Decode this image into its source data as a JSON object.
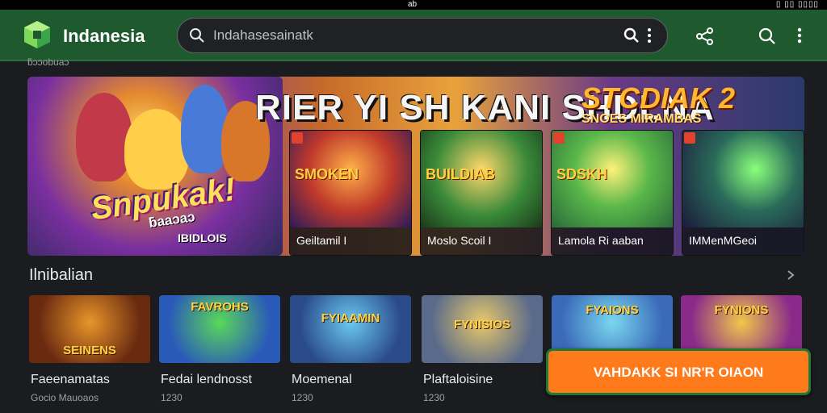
{
  "status_bar": {
    "center": "ab",
    "right": "▯  ▯▯  ▯▯▯▯"
  },
  "app": {
    "title": "Indanesia"
  },
  "search": {
    "placeholder": "Indahasesainatk"
  },
  "crumb": "ƃɔɔobuaɔ",
  "banner": {
    "headline": "RIER YI SH KANI SHDLNA",
    "logo": "STCDIAK 2",
    "logo_sub": "SNOES MIRAMBAS",
    "hero_title": "Snpukak!",
    "hero_sub": "ƃaaɔaɔ",
    "hero_tag": "IBIDLOIS",
    "cards": [
      {
        "label": "Geiltamil I",
        "art_title": "SMOKEN"
      },
      {
        "label": "Moslo Scoil  I",
        "art_title": "BUILDIAB"
      },
      {
        "label": "Lamola Ri aaban",
        "art_title": "SDSKH"
      },
      {
        "label": "IMMenMGeoi",
        "art_title": ""
      }
    ]
  },
  "section": {
    "title": "Ilnibalian"
  },
  "games": [
    {
      "name": "Faeenamatas",
      "sub": "Gocio Mauoaos",
      "thumb_title": "SEINENS"
    },
    {
      "name": "Fedai lendnosst",
      "sub": "1230",
      "thumb_title": "FAVROHS"
    },
    {
      "name": "Moemenal",
      "sub": "1230",
      "thumb_title": "FYIAAMIN"
    },
    {
      "name": "Plaftaloisine",
      "sub": "1230",
      "thumb_title": "FYNISIOS"
    },
    {
      "name": "",
      "sub": "",
      "thumb_title": "FYAIONS"
    },
    {
      "name": "",
      "sub": "",
      "thumb_title": "FYNIONS"
    }
  ],
  "cta": {
    "label": "VAHDAKK SI NR'R OIAON"
  },
  "colors": {
    "appbar": "#1f5a2e",
    "cta": "#ff7a1a",
    "background": "#1b1c1f"
  }
}
